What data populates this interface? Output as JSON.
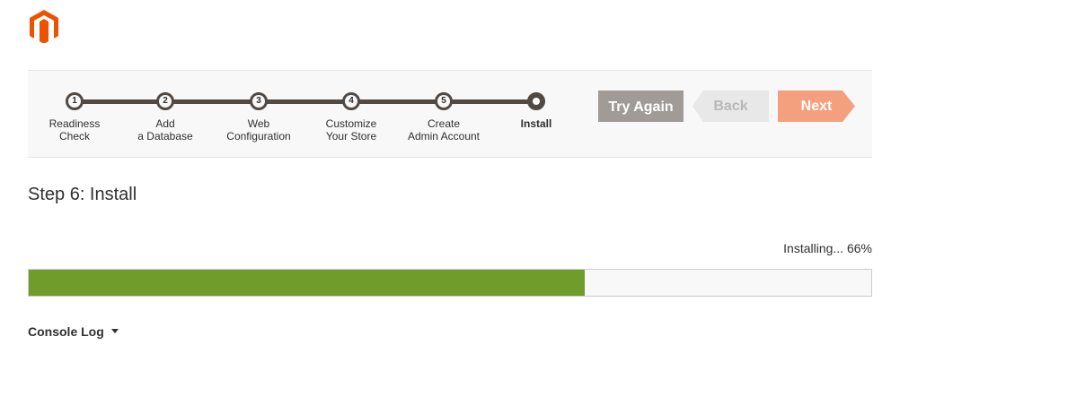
{
  "colors": {
    "brand": "#eb5202",
    "progress": "#6f9c2b",
    "step_dark": "#514943",
    "next_button": "#f4a07f",
    "try_again_button": "#a09b96"
  },
  "logo": {
    "icon": "magento-logo-icon"
  },
  "steps": [
    {
      "number": "1",
      "line1": "Readiness",
      "line2": "Check"
    },
    {
      "number": "2",
      "line1": "Add",
      "line2": "a Database"
    },
    {
      "number": "3",
      "line1": "Web",
      "line2": "Configuration"
    },
    {
      "number": "4",
      "line1": "Customize",
      "line2": "Your Store"
    },
    {
      "number": "5",
      "line1": "Create",
      "line2": "Admin Account"
    },
    {
      "number": "",
      "line1": "Install",
      "line2": "",
      "current": true
    }
  ],
  "buttons": {
    "try_again": "Try Again",
    "back": "Back",
    "next": "Next"
  },
  "page": {
    "title": "Step 6: Install"
  },
  "progress": {
    "text": "Installing... 66%",
    "percent": 66
  },
  "console": {
    "label": "Console Log",
    "icon": "caret-down-icon"
  }
}
